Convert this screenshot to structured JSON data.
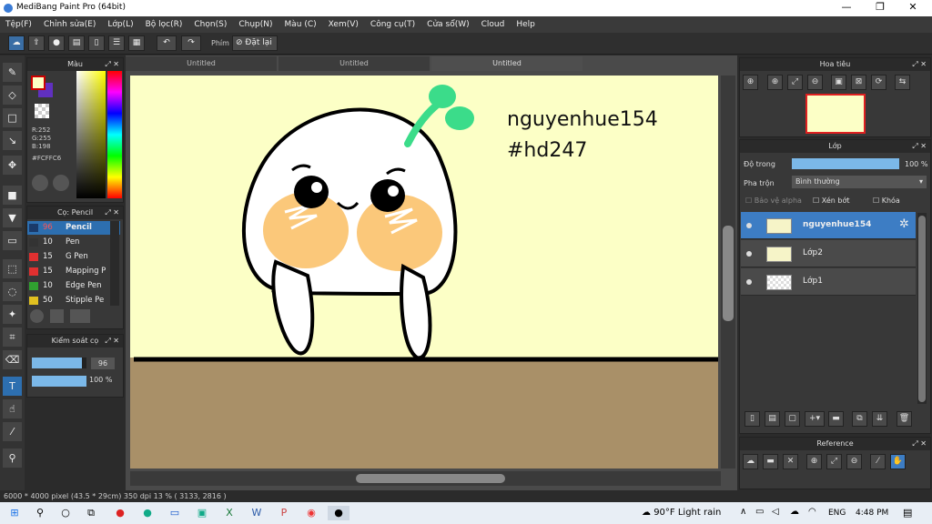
{
  "window": {
    "title": "MediBang Paint Pro (64bit)"
  },
  "menu": [
    "Tệp(F)",
    "Chỉnh sửa(E)",
    "Lớp(L)",
    "Bộ lọc(R)",
    "Chọn(S)",
    "Chụp(N)",
    "Màu (C)",
    "Xem(V)",
    "Công cụ(T)",
    "Cửa sổ(W)",
    "Cloud",
    "Help"
  ],
  "toolbar": {
    "phim_label": "Phím",
    "undo_label": "Đặt lại"
  },
  "tabs": [
    "Untitled",
    "Untitled",
    "Untitled"
  ],
  "color_panel": {
    "title": "Màu",
    "r": "R:252",
    "g": "G:255",
    "b": "B:198",
    "hex": "#FCFFC6",
    "primary": "#fcffc6"
  },
  "brush_panel": {
    "title": "Cọ: Pencil",
    "items": [
      {
        "size": "96",
        "name": "Pencil",
        "color": "#1a3a6a"
      },
      {
        "size": "10",
        "name": "Pen",
        "color": "#333333"
      },
      {
        "size": "15",
        "name": "G Pen",
        "color": "#e03030"
      },
      {
        "size": "15",
        "name": "Mapping P",
        "color": "#e03030"
      },
      {
        "size": "10",
        "name": "Edge Pen",
        "color": "#30a030"
      },
      {
        "size": "50",
        "name": "Stipple Pe",
        "color": "#e0c020"
      }
    ]
  },
  "brush_control": {
    "title": "Kiểm soát cọ",
    "size": "96",
    "opacity": "100 %",
    "size_fraction": 0.92,
    "opacity_fraction": 1.0
  },
  "canvas": {
    "text1": "nguyenhue154",
    "text2": "#hd247"
  },
  "navigator": {
    "title": "Hoa tiêu"
  },
  "layer_panel": {
    "title": "Lớp",
    "opacity_label": "Độ trong",
    "opacity_value": "100 %",
    "blend_label": "Pha trộn",
    "blend_value": "Bình thường",
    "protect_alpha": "Bảo vệ alpha",
    "clip": "Xén bớt",
    "lock": "Khóa",
    "layers": [
      {
        "name": "nguyenhue154",
        "active": true
      },
      {
        "name": "Lớp2",
        "active": false
      },
      {
        "name": "Lớp1",
        "active": false
      }
    ]
  },
  "reference": {
    "title": "Reference"
  },
  "status": {
    "text": "6000 * 4000 pixel   (43.5 * 29cm)   350 dpi   13 %   ( 3133, 2816 )"
  },
  "taskbar": {
    "weather": "90°F  Light rain",
    "lang": "ENG",
    "time": "4:48 PM"
  }
}
